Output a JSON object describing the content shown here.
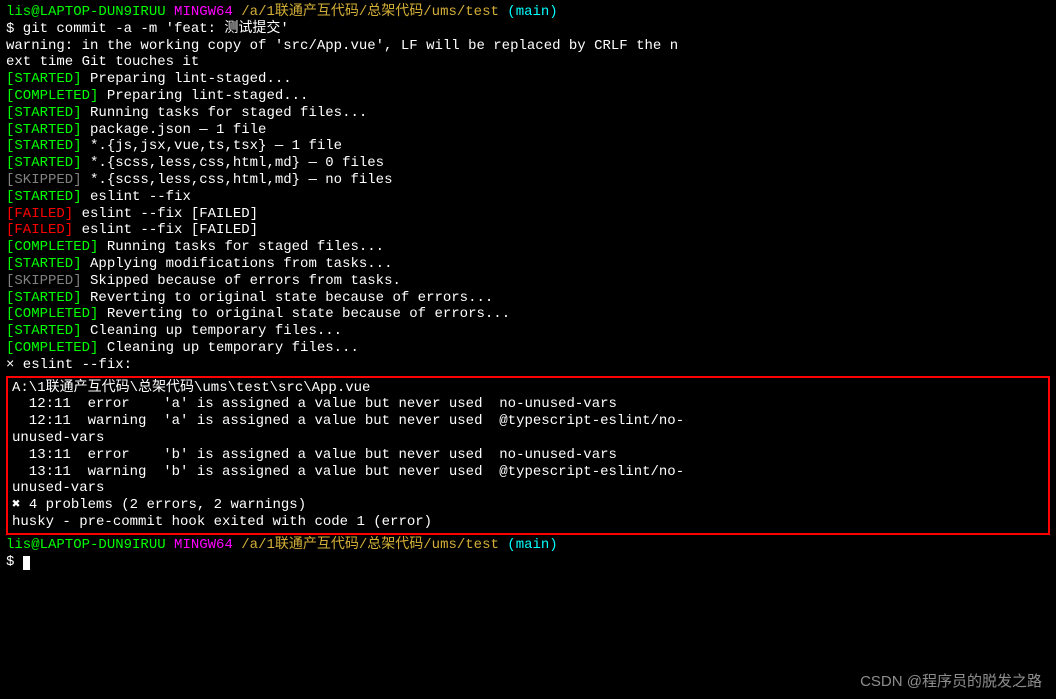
{
  "prompt1": {
    "user": "lis@LAPTOP-DUN9IRUU",
    "env": "MINGW64",
    "path": "/a/1联通产互代码/总架代码/ums/test",
    "branch": "(main)"
  },
  "command": "$ git commit -a -m 'feat: 测试提交'",
  "warning_l1": "warning: in the working copy of 'src/App.vue', LF will be replaced by CRLF the n",
  "warning_l2": "ext time Git touches it",
  "steps": [
    {
      "tag": "[STARTED]",
      "cls": "green",
      "msg": " Preparing lint-staged..."
    },
    {
      "tag": "[COMPLETED]",
      "cls": "green",
      "msg": " Preparing lint-staged..."
    },
    {
      "tag": "[STARTED]",
      "cls": "green",
      "msg": " Running tasks for staged files..."
    },
    {
      "tag": "[STARTED]",
      "cls": "green",
      "msg": " package.json — 1 file"
    },
    {
      "tag": "[STARTED]",
      "cls": "green",
      "msg": " *.{js,jsx,vue,ts,tsx} — 1 file"
    },
    {
      "tag": "[STARTED]",
      "cls": "green",
      "msg": " *.{scss,less,css,html,md} — 0 files"
    },
    {
      "tag": "[SKIPPED]",
      "cls": "gray",
      "msg": " *.{scss,less,css,html,md} — no files"
    },
    {
      "tag": "[STARTED]",
      "cls": "green",
      "msg": " eslint --fix"
    },
    {
      "tag": "[FAILED]",
      "cls": "red",
      "msg": " eslint --fix [FAILED]"
    },
    {
      "tag": "[FAILED]",
      "cls": "red",
      "msg": " eslint --fix [FAILED]"
    },
    {
      "tag": "[COMPLETED]",
      "cls": "green",
      "msg": " Running tasks for staged files..."
    },
    {
      "tag": "[STARTED]",
      "cls": "green",
      "msg": " Applying modifications from tasks..."
    },
    {
      "tag": "[SKIPPED]",
      "cls": "gray",
      "msg": " Skipped because of errors from tasks."
    },
    {
      "tag": "[STARTED]",
      "cls": "green",
      "msg": " Reverting to original state because of errors..."
    },
    {
      "tag": "[COMPLETED]",
      "cls": "green",
      "msg": " Reverting to original state because of errors..."
    },
    {
      "tag": "[STARTED]",
      "cls": "green",
      "msg": " Cleaning up temporary files..."
    },
    {
      "tag": "[COMPLETED]",
      "cls": "green",
      "msg": " Cleaning up temporary files..."
    }
  ],
  "blank": "",
  "fail_header": "× eslint --fix:",
  "box": {
    "filepath": "A:\\1联通产互代码\\总架代码\\ums\\test\\src\\App.vue",
    "l1": "  12:11  error    'a' is assigned a value but never used  no-unused-vars",
    "l2": "  12:11  warning  'a' is assigned a value but never used  @typescript-eslint/no-",
    "l2b": "unused-vars",
    "l3": "  13:11  error    'b' is assigned a value but never used  no-unused-vars",
    "l4": "  13:11  warning  'b' is assigned a value but never used  @typescript-eslint/no-",
    "l4b": "unused-vars",
    "summary_x": "✖ ",
    "summary": "4 problems (2 errors, 2 warnings)",
    "husky": "husky - pre-commit hook exited with code 1 (error)"
  },
  "prompt2": {
    "user": "lis@LAPTOP-DUN9IRUU",
    "env": "MINGW64",
    "path": "/a/1联通产互代码/总架代码/ums/test",
    "branch": "(main)"
  },
  "prompt2_line": "$ ",
  "watermark": "CSDN @程序员的脱发之路"
}
